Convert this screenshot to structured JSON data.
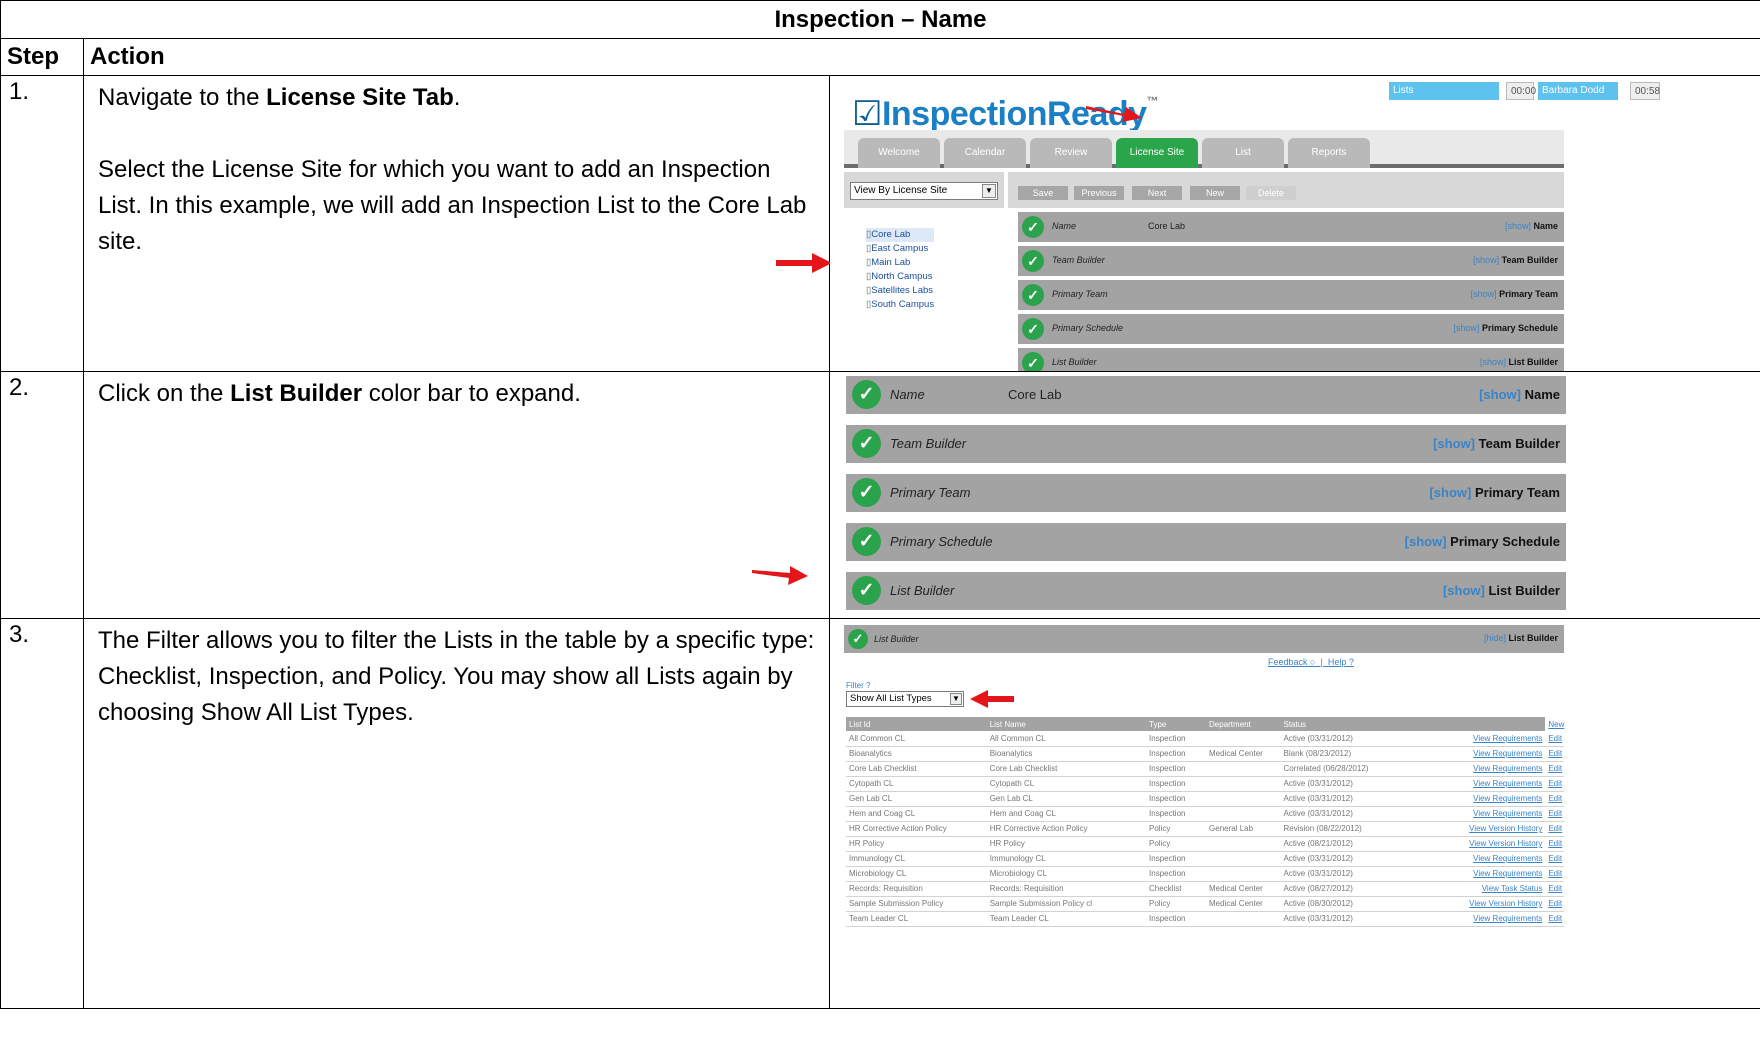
{
  "title": "Inspection – Name",
  "header": {
    "step": "Step",
    "action": "Action"
  },
  "steps": [
    {
      "num": "1.",
      "p1_pre": "Navigate to the ",
      "p1_bold": "License Site Tab",
      "p1_post": ".",
      "p2": "Select the License Site for which you want to add an Inspection List. In this example, we will add an Inspection List to the Core Lab site."
    },
    {
      "num": "2.",
      "p1_pre": "Click on the ",
      "p1_bold": "List Builder",
      "p1_post": " color bar to expand."
    },
    {
      "num": "3.",
      "p1": "The Filter allows you to filter the Lists in the table by a specific type: Checklist, Inspection, and Policy.  You may show all Lists again by choosing Show All List Types."
    }
  ],
  "app": {
    "logo": "InspectionReady",
    "logo_check": "☑",
    "logo_tm": "™",
    "top": {
      "lists": "Lists",
      "time1": "00:00",
      "user": "Barbara Dodd",
      "time2": "00:58"
    },
    "tabs": [
      "Welcome",
      "Calendar",
      "Review",
      "License Site",
      "List",
      "Reports"
    ],
    "active_tab": "License Site",
    "view_select": "View By License Site",
    "actions": [
      "Save",
      "Previous",
      "Next",
      "New",
      "Delete"
    ],
    "sites": [
      "Core Lab",
      "East Campus",
      "Main Lab",
      "North Campus",
      "Satellites Labs",
      "South Campus"
    ],
    "sections": [
      {
        "label": "Name",
        "value": "Core Lab",
        "show": "[show]",
        "right": "Name"
      },
      {
        "label": "Team Builder",
        "value": "",
        "show": "[show]",
        "right": "Team Builder"
      },
      {
        "label": "Primary Team",
        "value": "",
        "show": "[show]",
        "right": "Primary Team"
      },
      {
        "label": "Primary Schedule",
        "value": "",
        "show": "[show]",
        "right": "Primary Schedule"
      },
      {
        "label": "List Builder",
        "value": "",
        "show": "[show]",
        "right": "List Builder"
      }
    ],
    "list_builder": {
      "label": "List Builder",
      "hide": "[hide]",
      "right": "List Builder",
      "feedback": "Feedback",
      "help": "Help",
      "filter_label": "Filter",
      "filter_value": "Show All List Types",
      "columns": [
        "List Id",
        "List Name",
        "Type",
        "Department",
        "Status",
        "New"
      ],
      "rows": [
        [
          "All Common CL",
          "All Common CL",
          "Inspection",
          "",
          "Active (03/31/2012)",
          "View Requirements",
          "Edit"
        ],
        [
          "Bioanalytics",
          "Bioanalytics",
          "Inspection",
          "Medical Center",
          "Blank (08/23/2012)",
          "View Requirements",
          "Edit"
        ],
        [
          "Core Lab Checklist",
          "Core Lab Checklist",
          "Inspection",
          "",
          "Correlated (06/28/2012)",
          "View Requirements",
          "Edit"
        ],
        [
          "Cytopath CL",
          "Cytopath CL",
          "Inspection",
          "",
          "Active (03/31/2012)",
          "View Requirements",
          "Edit"
        ],
        [
          "Gen Lab CL",
          "Gen Lab CL",
          "Inspection",
          "",
          "Active (03/31/2012)",
          "View Requirements",
          "Edit"
        ],
        [
          "Hem and Coag CL",
          "Hem and Coag CL",
          "Inspection",
          "",
          "Active (03/31/2012)",
          "View Requirements",
          "Edit"
        ],
        [
          "HR Corrective Action Policy",
          "HR Corrective Action Policy",
          "Policy",
          "General Lab",
          "Revision (08/22/2012)",
          "View Version History",
          "Edit"
        ],
        [
          "HR Policy",
          "HR Policy",
          "Policy",
          "",
          "Active (08/21/2012)",
          "View Version History",
          "Edit"
        ],
        [
          "Immunology CL",
          "Immunology CL",
          "Inspection",
          "",
          "Active (03/31/2012)",
          "View Requirements",
          "Edit"
        ],
        [
          "Microbiology CL",
          "Microbiology CL",
          "Inspection",
          "",
          "Active (03/31/2012)",
          "View Requirements",
          "Edit"
        ],
        [
          "Records: Requisition",
          "Records: Requisition",
          "Checklist",
          "Medical Center",
          "Active (08/27/2012)",
          "View Task Status",
          "Edit"
        ],
        [
          "Sample Submission Policy",
          "Sample Submission Policy cl",
          "Policy",
          "Medical Center",
          "Active (08/30/2012)",
          "View Version History",
          "Edit"
        ],
        [
          "Team Leader CL",
          "Team Leader CL",
          "Inspection",
          "",
          "Active (03/31/2012)",
          "View Requirements",
          "Edit"
        ]
      ]
    }
  },
  "colors": {
    "arrow": "#e4161b",
    "green": "#2ba24c",
    "bar": "#a3a3a3",
    "link": "#3a83c6"
  }
}
